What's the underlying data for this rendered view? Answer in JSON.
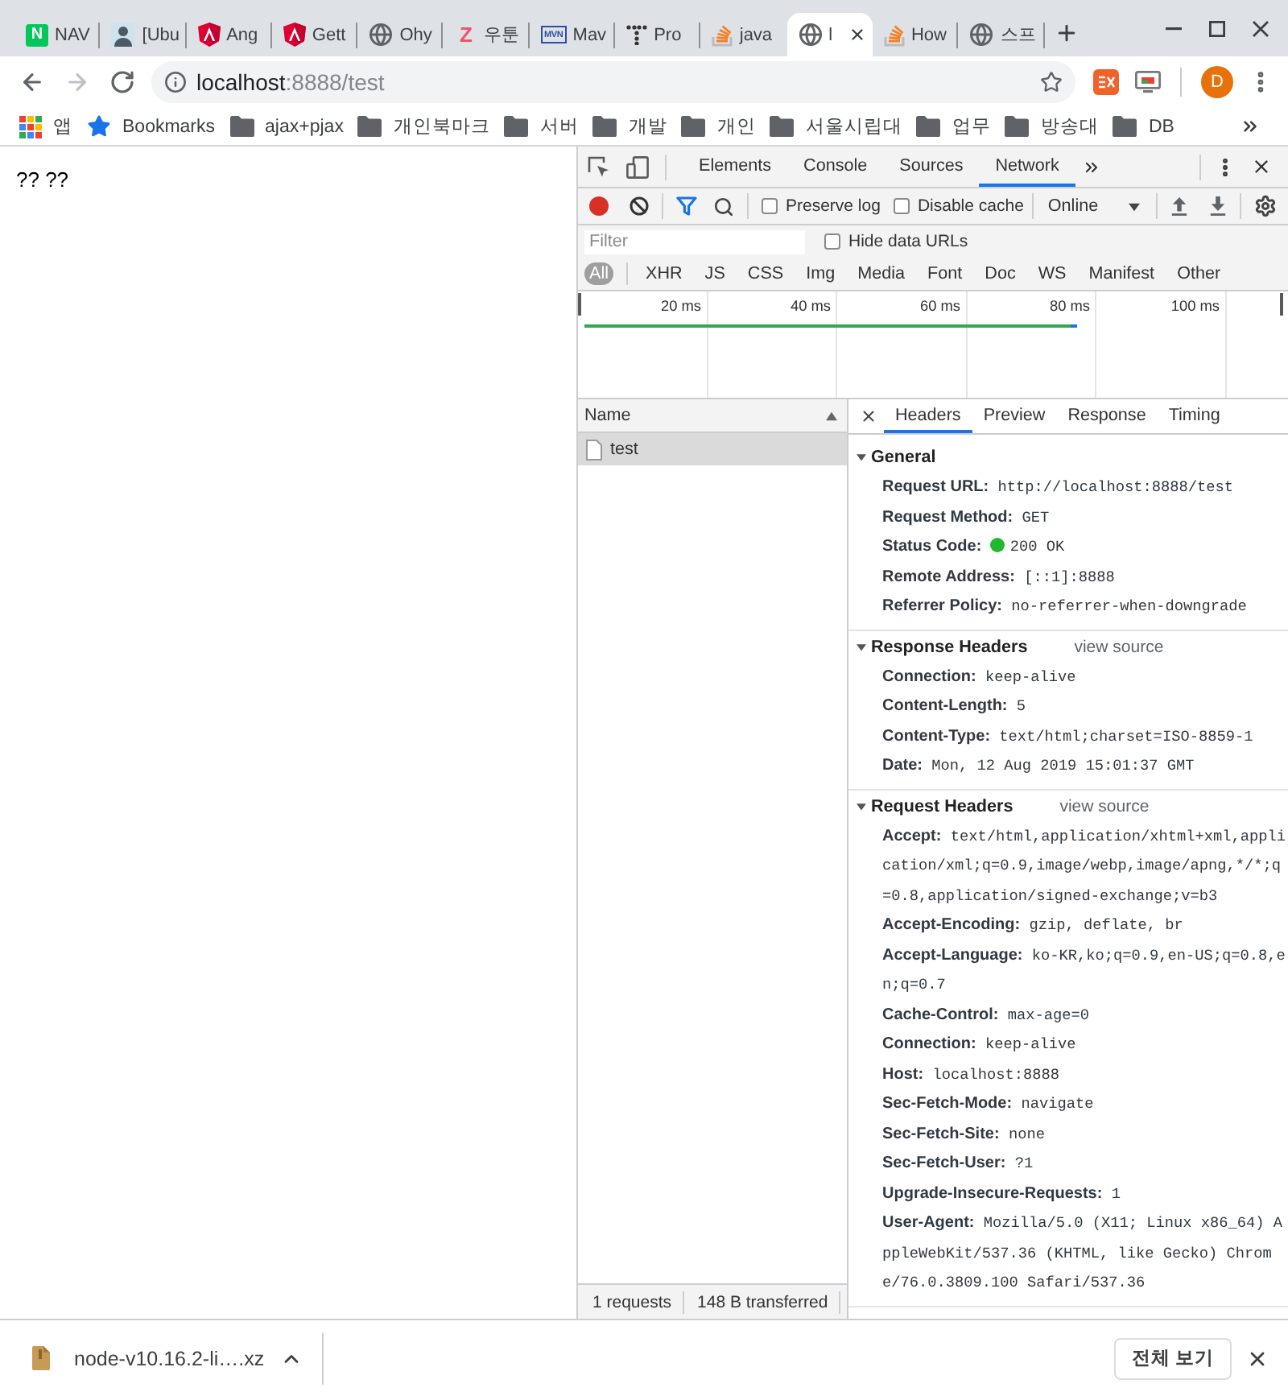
{
  "window": {
    "tabs": [
      {
        "title": "NAV",
        "kind": "tile",
        "favicon_text": "N",
        "selected": false
      },
      {
        "title": "[Ubu",
        "kind": "avatar",
        "selected": false
      },
      {
        "title": "Ang",
        "kind": "shield",
        "selected": false
      },
      {
        "title": "Gett",
        "kind": "shield",
        "selected": false
      },
      {
        "title": "Ohy",
        "kind": "globe",
        "selected": false
      },
      {
        "title": "우툰",
        "kind": "letter",
        "favicon_text": "Z",
        "selected": false
      },
      {
        "title": "Mav",
        "kind": "boxed",
        "favicon_text": "MVN",
        "selected": false
      },
      {
        "title": "Pro",
        "kind": "dots",
        "selected": false
      },
      {
        "title": "java",
        "kind": "stack",
        "selected": false
      },
      {
        "title": "l",
        "kind": "globe",
        "selected": true
      },
      {
        "title": "How",
        "kind": "stack",
        "selected": false
      },
      {
        "title": "스프",
        "kind": "globe",
        "selected": false
      }
    ]
  },
  "toolbar": {
    "address": {
      "host": "localhost",
      "path": ":8888/test"
    },
    "profile_initial": "D"
  },
  "bookmarks": [
    {
      "label": "앱",
      "kind": "apps"
    },
    {
      "label": "Bookmarks",
      "kind": "star"
    },
    {
      "label": "ajax+pjax",
      "kind": "folder"
    },
    {
      "label": "개인북마크",
      "kind": "folder"
    },
    {
      "label": "서버",
      "kind": "folder"
    },
    {
      "label": "개발",
      "kind": "folder"
    },
    {
      "label": "개인",
      "kind": "folder"
    },
    {
      "label": "서울시립대",
      "kind": "folder"
    },
    {
      "label": "업무",
      "kind": "folder"
    },
    {
      "label": "방송대",
      "kind": "folder"
    },
    {
      "label": "DB",
      "kind": "folder"
    }
  ],
  "page": {
    "text": "?? ??"
  },
  "devtools": {
    "panels": [
      {
        "label": "Elements",
        "selected": false
      },
      {
        "label": "Console",
        "selected": false
      },
      {
        "label": "Sources",
        "selected": false
      },
      {
        "label": "Network",
        "selected": true
      }
    ],
    "recording": true,
    "options": [
      {
        "label": "Preserve log",
        "checked": false
      },
      {
        "label": "Disable cache",
        "checked": false
      }
    ],
    "throttling": "Online",
    "filter": {
      "placeholder": "Filter"
    },
    "hide_data_urls": {
      "label": "Hide data URLs",
      "checked": false
    },
    "types": [
      {
        "label": "All",
        "selected": true
      },
      {
        "label": "XHR",
        "selected": false
      },
      {
        "label": "JS",
        "selected": false
      },
      {
        "label": "CSS",
        "selected": false
      },
      {
        "label": "Img",
        "selected": false
      },
      {
        "label": "Media",
        "selected": false
      },
      {
        "label": "Font",
        "selected": false
      },
      {
        "label": "Doc",
        "selected": false
      },
      {
        "label": "WS",
        "selected": false
      },
      {
        "label": "Manifest",
        "selected": false
      },
      {
        "label": "Other",
        "selected": false
      }
    ],
    "overview": {
      "ticks": [
        "20 ms",
        "40 ms",
        "60 ms",
        "80 ms",
        "100 ms"
      ]
    },
    "requests": {
      "column": "Name",
      "rows": [
        {
          "name": "test",
          "selected": true
        }
      ]
    },
    "summary": [
      "1 requests",
      "148 B transferred"
    ],
    "detail_tabs": [
      {
        "label": "Headers",
        "selected": true
      },
      {
        "label": "Preview",
        "selected": false
      },
      {
        "label": "Response",
        "selected": false
      },
      {
        "label": "Timing",
        "selected": false
      }
    ],
    "sections": [
      {
        "title": "General",
        "expanded": true,
        "rows": [
          {
            "key": "Request URL:",
            "value": "http://localhost:8888/test",
            "kind": "text"
          },
          {
            "key": "Request Method:",
            "value": "GET",
            "kind": "text"
          },
          {
            "key": "Status Code:",
            "value": "200 OK",
            "kind": "status"
          },
          {
            "key": "Remote Address:",
            "value": "[::1]:8888",
            "kind": "text"
          },
          {
            "key": "Referrer Policy:",
            "value": "no-referrer-when-downgrade",
            "kind": "text"
          }
        ]
      },
      {
        "title": "Response Headers",
        "link": "view source",
        "expanded": true,
        "rows": [
          {
            "key": "Connection:",
            "value": "keep-alive"
          },
          {
            "key": "Content-Length:",
            "value": "5"
          },
          {
            "key": "Content-Type:",
            "value": "text/html;charset=ISO-8859-1"
          },
          {
            "key": "Date:",
            "value": "Mon, 12 Aug 2019 15:01:37 GMT"
          }
        ]
      },
      {
        "title": "Request Headers",
        "link": "view source",
        "expanded": true,
        "rows": [
          {
            "key": "Accept:",
            "value": "text/html,application/xhtml+xml,application/xml;q=0.9,image/webp,image/apng,*/*;q=0.8,application/signed-exchange;v=b3"
          },
          {
            "key": "Accept-Encoding:",
            "value": "gzip, deflate, br"
          },
          {
            "key": "Accept-Language:",
            "value": "ko-KR,ko;q=0.9,en-US;q=0.8,en;q=0.7"
          },
          {
            "key": "Cache-Control:",
            "value": "max-age=0"
          },
          {
            "key": "Connection:",
            "value": "keep-alive"
          },
          {
            "key": "Host:",
            "value": "localhost:8888"
          },
          {
            "key": "Sec-Fetch-Mode:",
            "value": "navigate"
          },
          {
            "key": "Sec-Fetch-Site:",
            "value": "none"
          },
          {
            "key": "Sec-Fetch-User:",
            "value": "?1"
          },
          {
            "key": "Upgrade-Insecure-Requests:",
            "value": "1"
          },
          {
            "key": "User-Agent:",
            "value": "Mozilla/5.0 (X11; Linux x86_64) AppleWebKit/537.36 (KHTML, like Gecko) Chrome/76.0.3809.100 Safari/537.36"
          }
        ]
      }
    ]
  },
  "download_shelf": {
    "file": "node-v10.16.2-li….xz",
    "show_all": "전체 보기"
  }
}
